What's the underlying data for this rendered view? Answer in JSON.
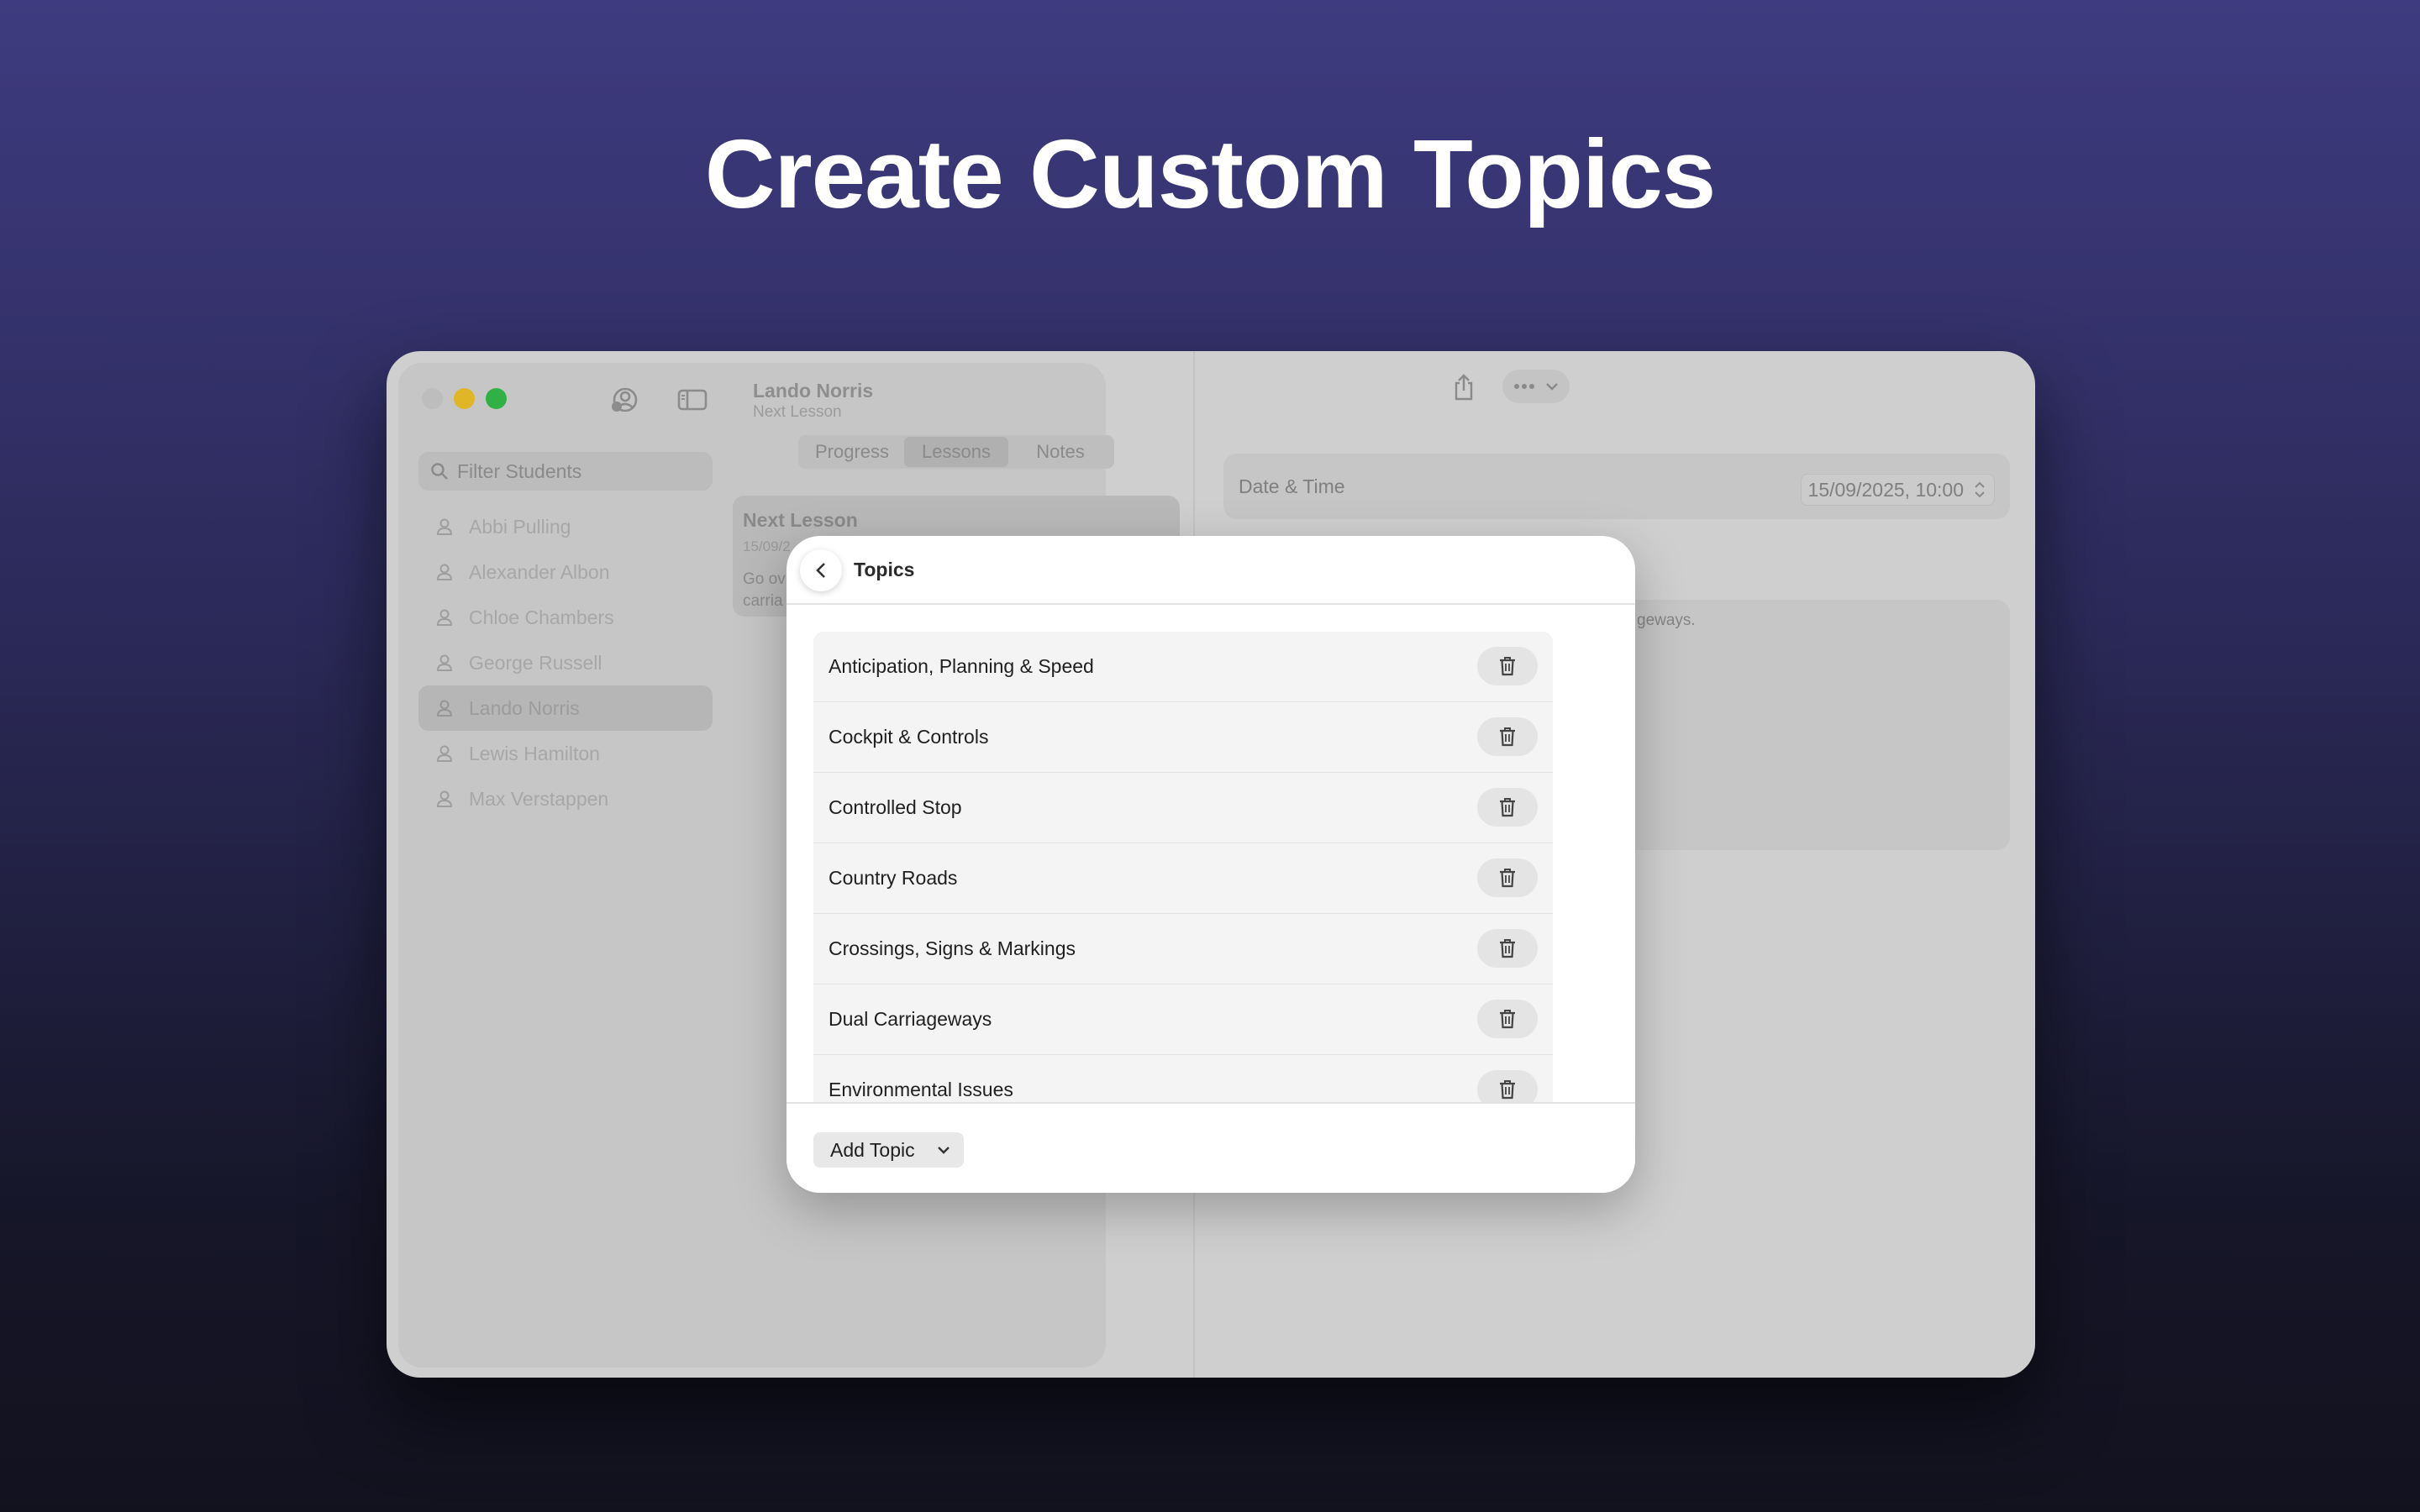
{
  "hero": {
    "title": "Create Custom Topics"
  },
  "sidebar": {
    "search_placeholder": "Filter Students",
    "students": [
      "Abbi Pulling",
      "Alexander Albon",
      "Chloe Chambers",
      "George Russell",
      "Lando Norris",
      "Lewis Hamilton",
      "Max Verstappen"
    ],
    "selected_index": 4
  },
  "middle": {
    "student_name": "Lando Norris",
    "subtitle": "Next Lesson",
    "tabs": [
      "Progress",
      "Lessons",
      "Notes"
    ],
    "active_tab": "Lessons",
    "lesson_card": {
      "title": "Next Lesson",
      "date": "15/09/2",
      "text": "Go ov carria"
    }
  },
  "detail": {
    "date_label": "Date & Time",
    "date_value": "15/09/2025, 10:00",
    "notes_fragment": "geways."
  },
  "sheet": {
    "title": "Topics",
    "topics": [
      "Anticipation, Planning & Speed",
      "Cockpit & Controls",
      "Controlled Stop",
      "Country Roads",
      "Crossings, Signs & Markings",
      "Dual Carriageways",
      "Environmental Issues"
    ],
    "add_button_label": "Add Topic"
  }
}
